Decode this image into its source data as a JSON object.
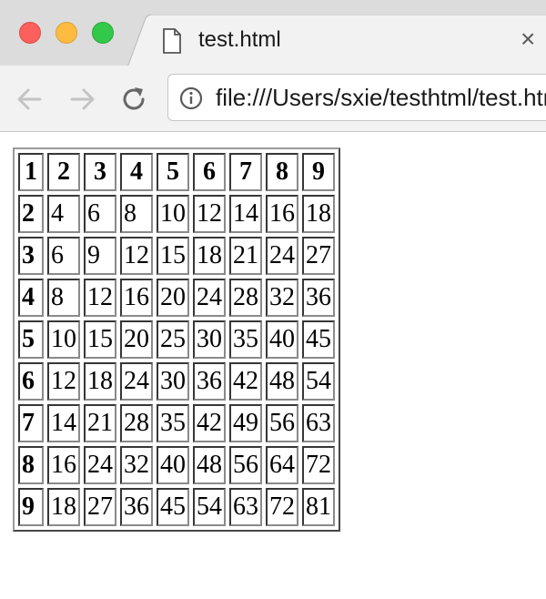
{
  "tab": {
    "title": "test.html",
    "close": "×"
  },
  "address_bar": {
    "url": "file:///Users/sxie/testhtml/test.html"
  },
  "table": {
    "rows": [
      [
        "1",
        "2",
        "3",
        "4",
        "5",
        "6",
        "7",
        "8",
        "9"
      ],
      [
        "2",
        "4",
        "6",
        "8",
        "10",
        "12",
        "14",
        "16",
        "18"
      ],
      [
        "3",
        "6",
        "9",
        "12",
        "15",
        "18",
        "21",
        "24",
        "27"
      ],
      [
        "4",
        "8",
        "12",
        "16",
        "20",
        "24",
        "28",
        "32",
        "36"
      ],
      [
        "5",
        "10",
        "15",
        "20",
        "25",
        "30",
        "35",
        "40",
        "45"
      ],
      [
        "6",
        "12",
        "18",
        "24",
        "30",
        "36",
        "42",
        "48",
        "54"
      ],
      [
        "7",
        "14",
        "21",
        "28",
        "35",
        "42",
        "49",
        "56",
        "63"
      ],
      [
        "8",
        "16",
        "24",
        "32",
        "40",
        "48",
        "56",
        "64",
        "72"
      ],
      [
        "9",
        "18",
        "27",
        "36",
        "45",
        "54",
        "63",
        "72",
        "81"
      ]
    ]
  }
}
